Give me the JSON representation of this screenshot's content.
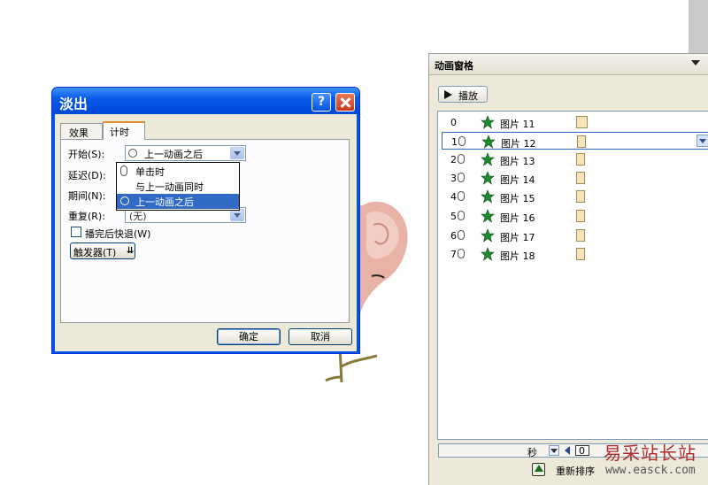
{
  "dialog": {
    "title": "淡出",
    "help_glyph": "?",
    "tabs": [
      "效果",
      "计时"
    ],
    "active_tab": "计时",
    "fields": {
      "start_label": "开始(S):",
      "start_value": "上一动画之后",
      "delay_label": "延迟(D):",
      "duration_label": "期间(N):",
      "repeat_label": "重复(R):",
      "repeat_value": "(无)",
      "rewind_label": "播完后快退(W)",
      "rewind_checked": false,
      "trigger_label": "触发器(T)"
    },
    "start_options": [
      "单击时",
      "与上一动画同时",
      "上一动画之后"
    ],
    "selected_option": "上一动画之后",
    "ok_label": "确定",
    "cancel_label": "取消"
  },
  "pane": {
    "title": "动画窗格",
    "play_label": "播放",
    "items": [
      {
        "num": "0",
        "name": "图片 11"
      },
      {
        "num": "1",
        "name": "图片 12"
      },
      {
        "num": "2",
        "name": "图片 13"
      },
      {
        "num": "3",
        "name": "图片 14"
      },
      {
        "num": "4",
        "name": "图片 15"
      },
      {
        "num": "5",
        "name": "图片 16"
      },
      {
        "num": "6",
        "name": "图片 17"
      },
      {
        "num": "7",
        "name": "图片 18"
      }
    ],
    "selected_index": 1,
    "seconds_label": "秒",
    "timeline_value": "0",
    "reorder_label": "重新排序"
  },
  "watermark": {
    "text": "易采站长站",
    "url": "www.easck.com"
  },
  "colors": {
    "xp_title_blue": "#0055e5",
    "selection_blue": "#316ac5",
    "entrance_star_green": "#1d8a2e",
    "timeline_bar": "#f8e2b8"
  },
  "icons": [
    "help-icon",
    "close-icon",
    "clock-icon",
    "mouse-icon",
    "entrance-star-icon",
    "play-icon",
    "reorder-icon",
    "chevron-down-icon"
  ]
}
